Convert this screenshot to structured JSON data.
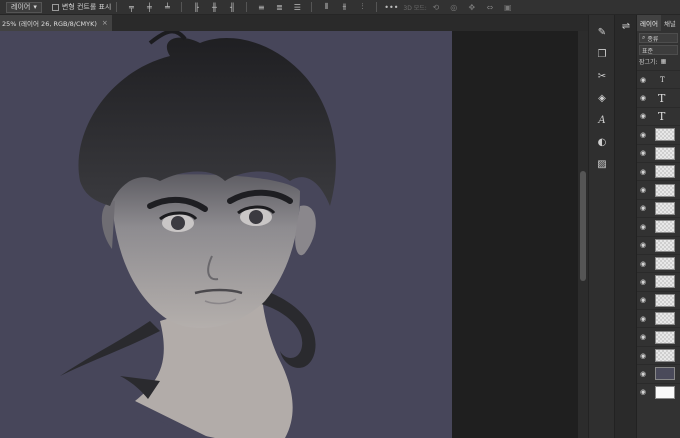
{
  "options_bar": {
    "layer_select": "레이어",
    "show_transform_label": "변형 컨트롤 표시",
    "mode_3d_label": "3D 모드:"
  },
  "document_tab": {
    "title": "25% (레이어 26, RGB/8/CMYK)",
    "close": "×"
  },
  "layers_panel": {
    "tab_layers": "레이어",
    "tab_channels": "채널",
    "filter_label": "종류",
    "blend_mode": "표준",
    "lock_label": "잠그기:"
  },
  "layer_rows": [
    {
      "type": "adjust",
      "glyph": "T",
      "visible": true
    },
    {
      "type": "text",
      "glyph": "T",
      "visible": true
    },
    {
      "type": "text",
      "glyph": "T",
      "visible": true
    },
    {
      "type": "pixel",
      "visible": true
    },
    {
      "type": "pixel",
      "visible": true
    },
    {
      "type": "pixel",
      "visible": true
    },
    {
      "type": "pixel",
      "visible": true
    },
    {
      "type": "pixel",
      "visible": true
    },
    {
      "type": "pixel",
      "visible": true
    },
    {
      "type": "pixel",
      "visible": true
    },
    {
      "type": "pixel",
      "visible": true
    },
    {
      "type": "pixel",
      "visible": true
    },
    {
      "type": "pixel",
      "visible": true
    },
    {
      "type": "pixel",
      "visible": true
    },
    {
      "type": "pixel",
      "visible": true
    },
    {
      "type": "pixel",
      "visible": true
    },
    {
      "type": "dark",
      "visible": true
    },
    {
      "type": "white",
      "visible": true
    }
  ],
  "colors": {
    "canvas_bg": "#47465a",
    "workspace": "#1f1f1f",
    "panel": "#323232"
  }
}
